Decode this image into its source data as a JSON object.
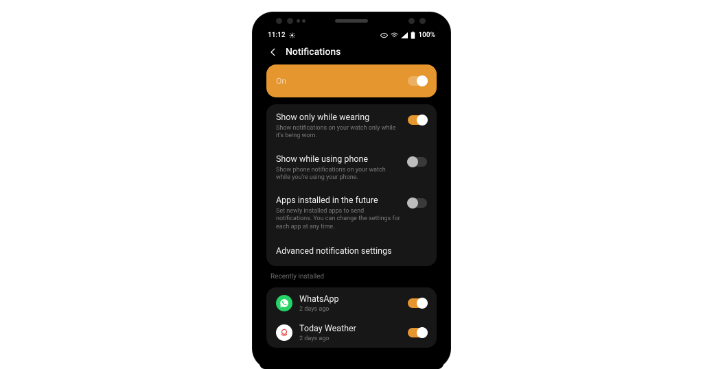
{
  "statusbar": {
    "time": "11:12",
    "battery": "100%"
  },
  "appbar": {
    "title": "Notifications"
  },
  "master_toggle": {
    "label": "On",
    "on": true
  },
  "settings": [
    {
      "title": "Show only while wearing",
      "sub": "Show notifications on your watch only while it's being worn.",
      "on": true
    },
    {
      "title": "Show while using phone",
      "sub": "Show phone notifications on your watch while you're using your phone.",
      "on": false
    },
    {
      "title": "Apps installed in the future",
      "sub": "Set newly installed apps to send notifications. You can change the settings for each app at any time.",
      "on": false
    }
  ],
  "advanced_label": "Advanced notification settings",
  "section_label": "Recently installed",
  "apps": [
    {
      "name": "WhatsApp",
      "sub": "2 days ago",
      "on": true
    },
    {
      "name": "Today Weather",
      "sub": "2 days ago",
      "on": true
    }
  ]
}
